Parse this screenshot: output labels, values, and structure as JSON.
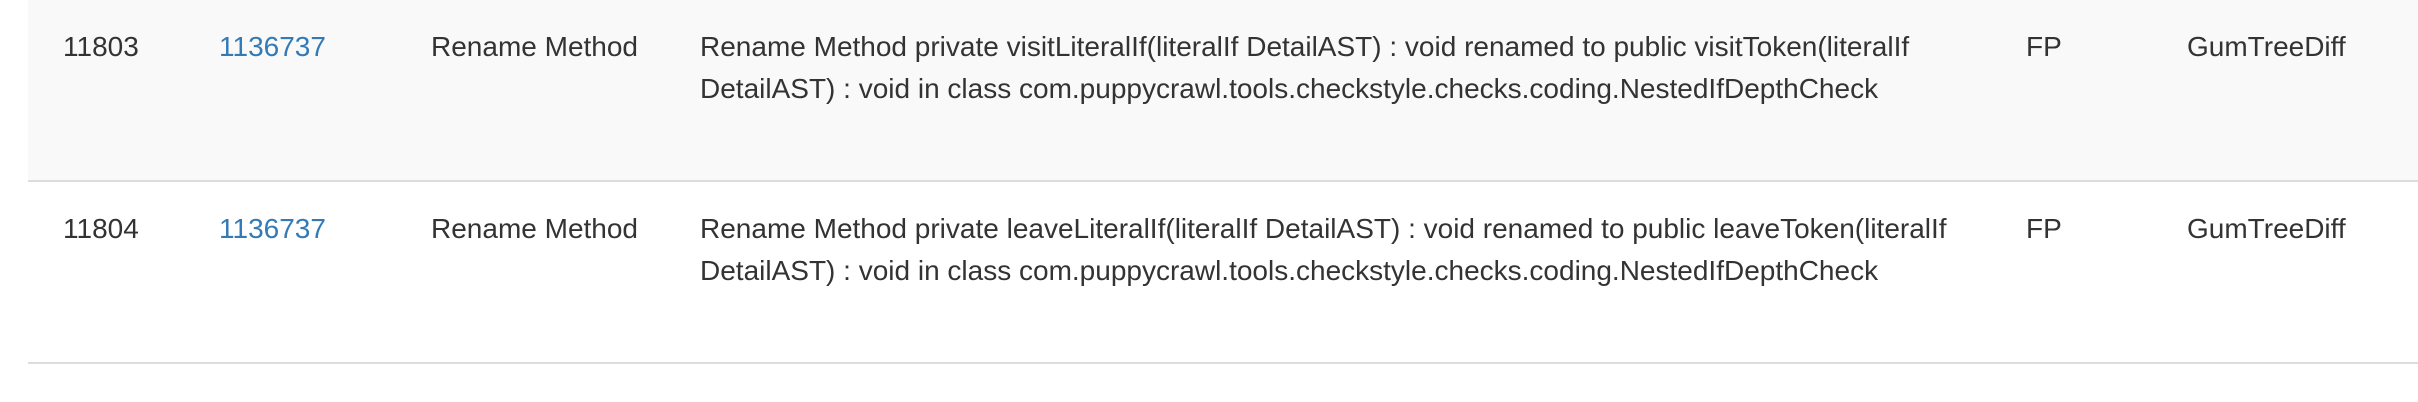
{
  "rows": [
    {
      "id": "11803",
      "commit": "1136737",
      "refactoring_type": "Rename Method",
      "description": "Rename Method private visitLiteralIf(literalIf DetailAST) : void renamed to public visitToken(literalIf DetailAST) : void in class com.puppycrawl.tools.checkstyle.checks.coding.NestedIfDepthCheck",
      "status": "FP",
      "tool": "GumTreeDiff"
    },
    {
      "id": "11804",
      "commit": "1136737",
      "refactoring_type": "Rename Method",
      "description": "Rename Method private leaveLiteralIf(literalIf DetailAST) : void renamed to public leaveToken(literalIf DetailAST) : void in class com.puppycrawl.tools.checkstyle.checks.coding.NestedIfDepthCheck",
      "status": "FP",
      "tool": "GumTreeDiff"
    }
  ]
}
